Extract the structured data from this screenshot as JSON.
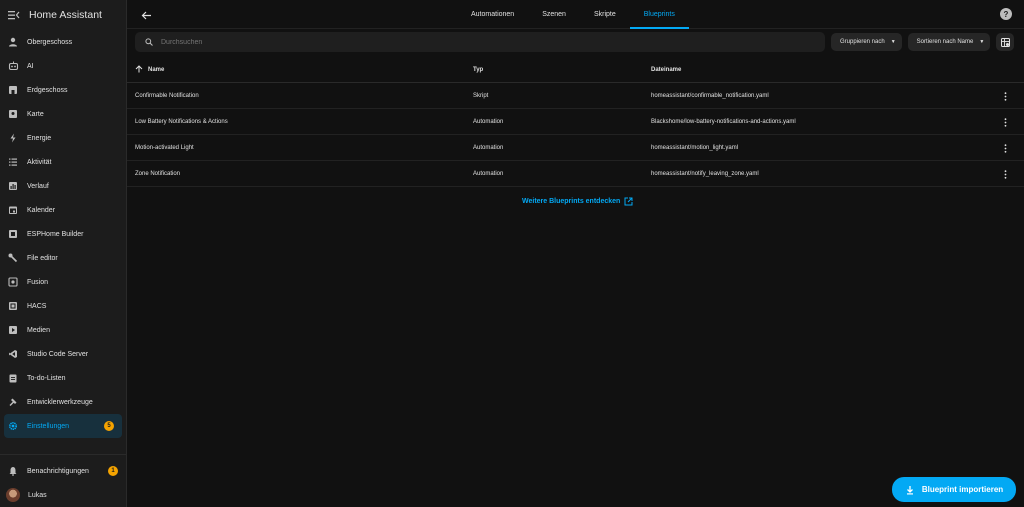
{
  "app": {
    "title": "Home Assistant"
  },
  "sidebar": {
    "items": [
      {
        "label": "Obergeschoss",
        "icon": "account-icon"
      },
      {
        "label": "AI",
        "icon": "robot-icon"
      },
      {
        "label": "Erdgeschoss",
        "icon": "home-icon"
      },
      {
        "label": "Karte",
        "icon": "map-icon"
      },
      {
        "label": "Energie",
        "icon": "lightning-bolt-icon"
      },
      {
        "label": "Aktivität",
        "icon": "format-list-icon"
      },
      {
        "label": "Verlauf",
        "icon": "chart-box-icon"
      },
      {
        "label": "Kalender",
        "icon": "calendar-icon"
      },
      {
        "label": "ESPHome Builder",
        "icon": "esphome-icon"
      },
      {
        "label": "File editor",
        "icon": "wrench-icon"
      },
      {
        "label": "Fusion",
        "icon": "fusion-icon"
      },
      {
        "label": "HACS",
        "icon": "hacs-icon"
      },
      {
        "label": "Medien",
        "icon": "play-box-icon"
      },
      {
        "label": "Studio Code Server",
        "icon": "vscode-icon"
      },
      {
        "label": "To-do-Listen",
        "icon": "clipboard-list-icon"
      },
      {
        "label": "Entwicklerwerkzeuge",
        "icon": "hammer-icon"
      },
      {
        "label": "Einstellungen",
        "icon": "cog-icon",
        "badge": "5",
        "active": true
      }
    ],
    "notifications": {
      "label": "Benachrichtigungen",
      "badge": "1"
    },
    "user": {
      "label": "Lukas"
    }
  },
  "tabs": [
    {
      "label": "Automationen"
    },
    {
      "label": "Szenen"
    },
    {
      "label": "Skripte"
    },
    {
      "label": "Blueprints",
      "active": true
    }
  ],
  "search": {
    "placeholder": "Durchsuchen"
  },
  "toolbar": {
    "group_label": "Gruppieren nach",
    "sort_label": "Sortieren nach Name"
  },
  "table": {
    "headers": {
      "name": "Name",
      "type": "Typ",
      "file": "Dateiname"
    },
    "rows": [
      {
        "name": "Confirmable Notification",
        "type": "Skript",
        "file": "homeassistant/confirmable_notification.yaml"
      },
      {
        "name": "Low Battery Notifications & Actions",
        "type": "Automation",
        "file": "Blackshome/low-battery-notifications-and-actions.yaml"
      },
      {
        "name": "Motion-activated Light",
        "type": "Automation",
        "file": "homeassistant/motion_light.yaml"
      },
      {
        "name": "Zone Notification",
        "type": "Automation",
        "file": "homeassistant/notify_leaving_zone.yaml"
      }
    ]
  },
  "discover_link": "Weitere Blueprints entdecken",
  "fab": {
    "label": "Blueprint importieren"
  },
  "colors": {
    "accent": "#03a9f4",
    "badge": "#f4a300",
    "sidebar_bg": "#1c1c1c",
    "main_bg": "#111111"
  }
}
